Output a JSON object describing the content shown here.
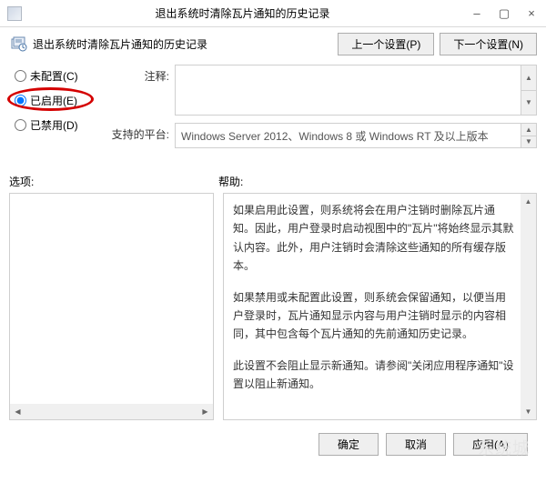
{
  "window": {
    "title": "退出系统时清除瓦片通知的历史记录",
    "min_glyph": "–",
    "max_glyph": "▢",
    "close_glyph": "×"
  },
  "header": {
    "label": "退出系统时清除瓦片通知的历史记录",
    "prev_btn": "上一个设置(P)",
    "next_btn": "下一个设置(N)"
  },
  "radios": {
    "not_configured": "未配置(C)",
    "enabled": "已启用(E)",
    "disabled": "已禁用(D)",
    "selected": "enabled"
  },
  "fields": {
    "comment_label": "注释:",
    "comment_value": "",
    "platform_label": "支持的平台:",
    "platform_value": "Windows Server 2012、Windows 8 或 Windows RT 及以上版本"
  },
  "sections": {
    "options_label": "选项:",
    "help_label": "帮助:"
  },
  "help": {
    "p1": "如果启用此设置，则系统将会在用户注销时删除瓦片通知。因此，用户登录时启动视图中的\"瓦片\"将始终显示其默认内容。此外，用户注销时会清除这些通知的所有缓存版本。",
    "p2": "如果禁用或未配置此设置，则系统会保留通知，以便当用户登录时，瓦片通知显示内容与用户注销时显示的内容相同，其中包含每个瓦片通知的先前通知历史记录。",
    "p3": "此设置不会阻止显示新通知。请参阅\"关闭应用程序通知\"设置以阻止新通知。"
  },
  "footer": {
    "ok": "确定",
    "cancel": "取消",
    "apply": "应用(A)"
  },
  "watermark": "系统城"
}
